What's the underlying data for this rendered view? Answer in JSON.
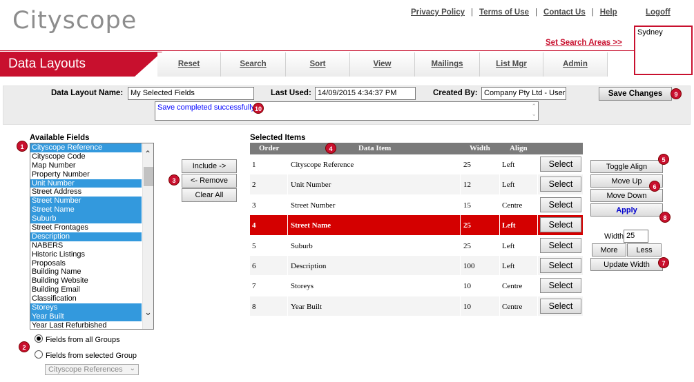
{
  "app": {
    "logo": "Cityscope",
    "page_title": "Data Layouts"
  },
  "top_links": [
    "Privacy Policy",
    "Terms of Use",
    "Contact Us",
    "Help"
  ],
  "logoff": "Logoff",
  "search_area": {
    "link": "Set Search Areas >>",
    "selected": "Sydney"
  },
  "nav_tabs": [
    "Reset",
    "Search",
    "Sort",
    "View",
    "Mailings",
    "List Mgr",
    "Admin"
  ],
  "form": {
    "layout_name_label": "Data Layout Name:",
    "layout_name_value": "My Selected Fields",
    "last_used_label": "Last Used:",
    "last_used_value": "14/09/2015 4:34:37 PM",
    "created_by_label": "Created By:",
    "created_by_value": "Company Pty Ltd - User",
    "save_button": "Save Changes",
    "message": "Save completed successfully."
  },
  "available_fields": {
    "title": "Available Fields",
    "items": [
      {
        "label": "Cityscope Reference",
        "selected": true
      },
      {
        "label": "Cityscope Code",
        "selected": false
      },
      {
        "label": "Map Number",
        "selected": false
      },
      {
        "label": "Property Number",
        "selected": false
      },
      {
        "label": "Unit Number",
        "selected": true
      },
      {
        "label": "Street Address",
        "selected": false
      },
      {
        "label": "Street Number",
        "selected": true
      },
      {
        "label": "Street Name",
        "selected": true
      },
      {
        "label": "Suburb",
        "selected": true
      },
      {
        "label": "Street Frontages",
        "selected": false
      },
      {
        "label": "Description",
        "selected": true
      },
      {
        "label": "NABERS",
        "selected": false
      },
      {
        "label": "Historic Listings",
        "selected": false
      },
      {
        "label": "Proposals",
        "selected": false
      },
      {
        "label": "Building Name",
        "selected": false
      },
      {
        "label": "Building Website",
        "selected": false
      },
      {
        "label": "Building Email",
        "selected": false
      },
      {
        "label": "Classification",
        "selected": false
      },
      {
        "label": "Storeys",
        "selected": true
      },
      {
        "label": "Year Built",
        "selected": true
      },
      {
        "label": "Year Last Refurbished",
        "selected": false
      }
    ]
  },
  "transfer_buttons": {
    "include": "Include ->",
    "remove": "<- Remove",
    "clear_all": "Clear All"
  },
  "groups": {
    "all_label": "Fields from all Groups",
    "selected_label": "Fields from selected Group",
    "dropdown_value": "Cityscope References"
  },
  "selected_items": {
    "title": "Selected Items",
    "headers": [
      "Order",
      "Data Item",
      "Width",
      "Align"
    ],
    "select_label": "Select",
    "rows": [
      {
        "order": "1",
        "item": "Cityscope Reference",
        "width": "25",
        "align": "Left",
        "highlighted": false
      },
      {
        "order": "2",
        "item": "Unit Number",
        "width": "12",
        "align": "Left",
        "highlighted": false
      },
      {
        "order": "3",
        "item": "Street Number",
        "width": "15",
        "align": "Centre",
        "highlighted": false
      },
      {
        "order": "4",
        "item": "Street Name",
        "width": "25",
        "align": "Left",
        "highlighted": true
      },
      {
        "order": "5",
        "item": "Suburb",
        "width": "25",
        "align": "Left",
        "highlighted": false
      },
      {
        "order": "6",
        "item": "Description",
        "width": "100",
        "align": "Left",
        "highlighted": false
      },
      {
        "order": "7",
        "item": "Storeys",
        "width": "10",
        "align": "Centre",
        "highlighted": false
      },
      {
        "order": "8",
        "item": "Year Built",
        "width": "10",
        "align": "Centre",
        "highlighted": false
      }
    ]
  },
  "right_controls": {
    "toggle_align": "Toggle Align",
    "move_up": "Move Up",
    "move_down": "Move Down",
    "apply": "Apply",
    "width_label": "Width",
    "width_value": "25",
    "more": "More",
    "less": "Less",
    "update_width": "Update Width"
  },
  "badges": [
    "1",
    "2",
    "3",
    "4",
    "5",
    "6",
    "7",
    "8",
    "9",
    "10"
  ],
  "colors": {
    "brand_red": "#c8102e",
    "selection_blue": "#3399dd",
    "highlight_row": "#d40000"
  }
}
